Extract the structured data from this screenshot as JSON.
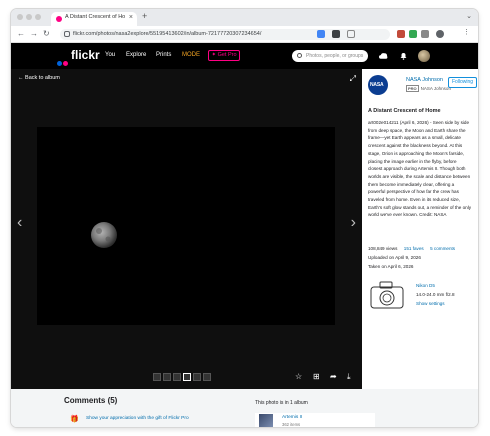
{
  "browser": {
    "tab_title": "A Distant Crescent of Home",
    "new_tab": "+",
    "tab_close": "×",
    "url": "flickr.com/photos/nasa2explore/55195413602/in/album-72177720307234654/"
  },
  "header": {
    "logo": "flickr",
    "nav": [
      "You",
      "Explore",
      "Prints",
      "MODE"
    ],
    "get_pro": "Get Pro",
    "search_placeholder": "Photos, people, or groups"
  },
  "viewer": {
    "back_label": "Back to album"
  },
  "owner": {
    "logo_text": "NASA",
    "name": "NASA Johnson",
    "pro_badge": "PRO",
    "pro_name": "NASA Johnson",
    "follow_label": "Following"
  },
  "photo": {
    "title": "A Distant Crescent of Home",
    "description": "art002e014211 (April 6, 2026) - Seen side by side from deep space, the Moon and Earth share the frame—yet Earth appears as a small, delicate crescent against the blackness beyond. At this stage, Orion is approaching the Moon's farside, placing the image earlier in the flyby, before closest approach during Artemis II. Though both worlds are visible, the scale and distance between them become immediately clear, offering a powerful perspective of how far the crew has traveled from home. Even in its reduced size, Earth's soft glow stands out, a reminder of the only world we've ever known. Credit: NASA",
    "views": "108,849 views",
    "faves": "151 faves",
    "comments": "5 comments",
    "uploaded": "Uploaded on April 9, 2026",
    "taken": "Taken on April 6, 2026"
  },
  "camera": {
    "name": "Nikon D5",
    "lens": "14.0-24.0 mm f/2.8",
    "settings_link": "Show settings"
  },
  "comments": {
    "title": "Comments (5)",
    "gift_text": "Show your appreciation with the gift of Flickr Pro"
  },
  "album": {
    "heading": "This photo is in 1 album",
    "name": "Artemis II",
    "count": "362 items"
  },
  "colors": {
    "flickr_blue": "#0063dc",
    "flickr_pink": "#ff0084",
    "link": "#006dac",
    "mode": "#f5a623"
  }
}
